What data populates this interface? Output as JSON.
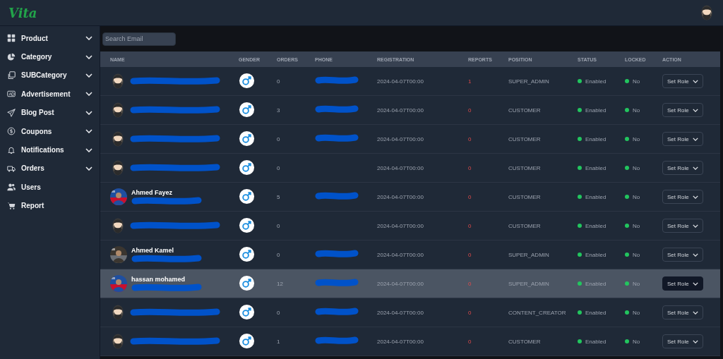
{
  "header": {
    "logo": "Vita"
  },
  "sidebar": {
    "items": [
      {
        "label": "Product",
        "expandable": true
      },
      {
        "label": "Category",
        "expandable": true
      },
      {
        "label": "SUBCategory",
        "expandable": true
      },
      {
        "label": "Advertisement",
        "expandable": true
      },
      {
        "label": "Blog Post",
        "expandable": true
      },
      {
        "label": "Coupons",
        "expandable": true
      },
      {
        "label": "Notifications",
        "expandable": true
      },
      {
        "label": "Orders",
        "expandable": true
      },
      {
        "label": "Users",
        "expandable": false
      },
      {
        "label": "Report",
        "expandable": false
      }
    ]
  },
  "search": {
    "placeholder": "Search Email"
  },
  "table": {
    "columns": [
      "NAME",
      "GENDER",
      "ORDERS",
      "PHONE",
      "REGISTRATION",
      "REPORTS",
      "POSITION",
      "STATUS",
      "LOCKED",
      "ACTION"
    ],
    "rows": [
      {
        "avatar": {
          "kind": "default"
        },
        "orders": "0",
        "phone_redacted": true,
        "registration": "2024-04-07T00:00",
        "reports": "1",
        "position": "SUPER_ADMIN",
        "status": "Enabled",
        "locked": "No",
        "action": "Set Role",
        "selected": false
      },
      {
        "avatar": {
          "kind": "default"
        },
        "orders": "3",
        "phone_redacted": true,
        "registration": "2024-04-07T00:00",
        "reports": "0",
        "position": "CUSTOMER",
        "status": "Enabled",
        "locked": "No",
        "action": "Set Role",
        "selected": false
      },
      {
        "avatar": {
          "kind": "default"
        },
        "orders": "0",
        "phone_redacted": true,
        "registration": "2024-04-07T00:00",
        "reports": "0",
        "position": "CUSTOMER",
        "status": "Enabled",
        "locked": "No",
        "action": "Set Role",
        "selected": false
      },
      {
        "avatar": {
          "kind": "default"
        },
        "orders": "0",
        "phone_redacted": false,
        "registration": "2024-04-07T00:00",
        "reports": "0",
        "position": "CUSTOMER",
        "status": "Enabled",
        "locked": "No",
        "action": "Set Role",
        "selected": false
      },
      {
        "name": "Ahmed Fayez",
        "orders": "5",
        "phone_redacted": true,
        "registration": "2024-04-07T00:00",
        "reports": "0",
        "position": "CUSTOMER",
        "status": "Enabled",
        "locked": "No",
        "action": "Set Role",
        "selected": false
      },
      {
        "avatar": {
          "kind": "default"
        },
        "orders": "0",
        "phone_redacted": false,
        "registration": "2024-04-07T00:00",
        "reports": "0",
        "position": "CUSTOMER",
        "status": "Enabled",
        "locked": "No",
        "action": "Set Role",
        "selected": false
      },
      {
        "name": "Ahmed Kamel",
        "orders": "0",
        "phone_redacted": true,
        "registration": "2024-04-07T00:00",
        "reports": "0",
        "position": "SUPER_ADMIN",
        "status": "Enabled",
        "locked": "No",
        "action": "Set Role",
        "selected": false
      },
      {
        "name": "hassan mohamed",
        "orders": "12",
        "phone_redacted": true,
        "registration": "2024-04-07T00:00",
        "reports": "0",
        "position": "SUPER_ADMIN",
        "status": "Enabled",
        "locked": "No",
        "action": "Set Role",
        "selected": true
      },
      {
        "avatar": {
          "kind": "default"
        },
        "orders": "0",
        "phone_redacted": true,
        "registration": "2024-04-07T00:00",
        "reports": "0",
        "position": "CONTENT_CREATOR",
        "status": "Enabled",
        "locked": "No",
        "action": "Set Role",
        "selected": false
      },
      {
        "avatar": {
          "kind": "default"
        },
        "orders": "1",
        "phone_redacted": true,
        "registration": "2024-04-07T00:00",
        "reports": "0",
        "position": "CUSTOMER",
        "status": "Enabled",
        "locked": "No",
        "action": "Set Role",
        "selected": false
      }
    ]
  }
}
